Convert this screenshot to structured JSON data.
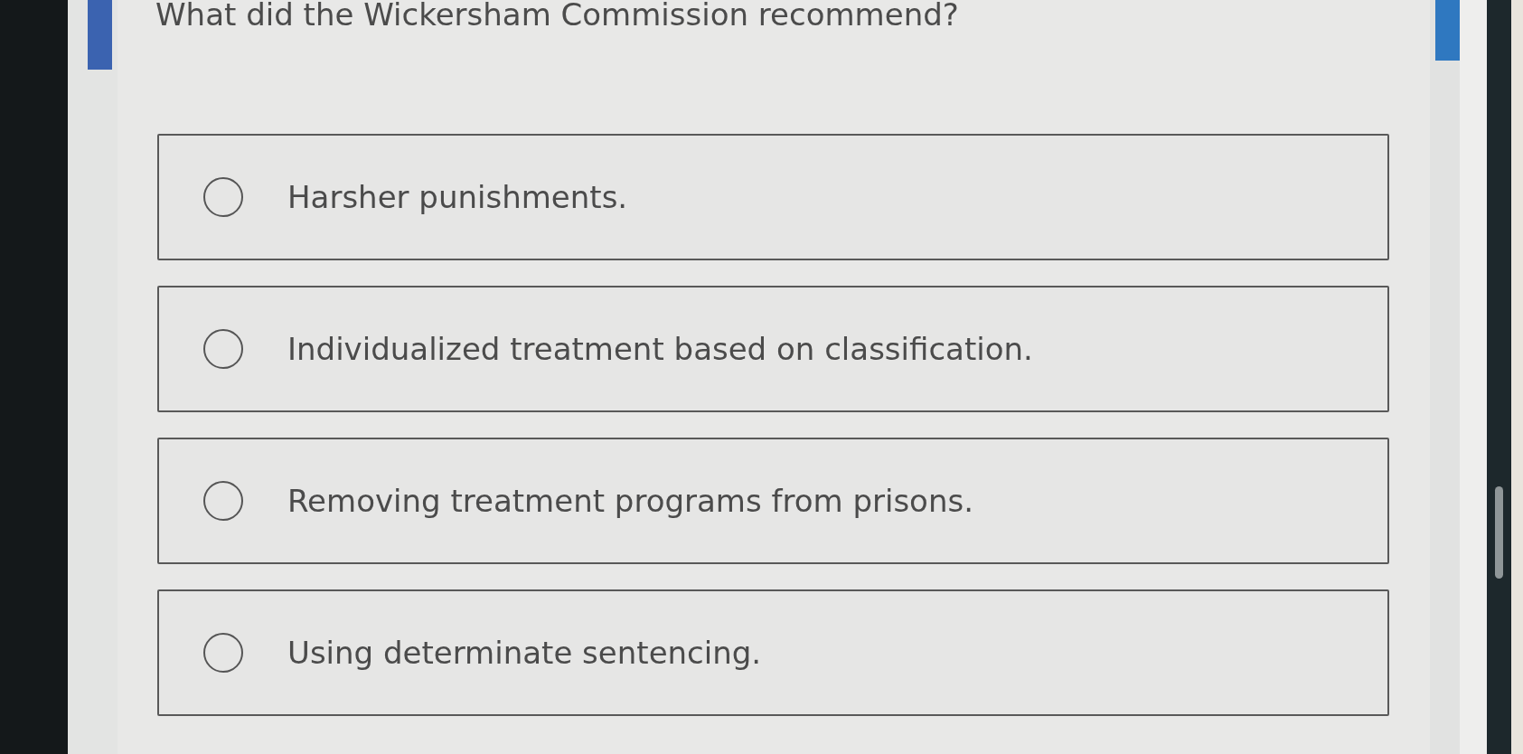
{
  "question": "What did the Wickersham Commission recommend?",
  "options": [
    {
      "label": "Harsher punishments.",
      "selected": false
    },
    {
      "label": "Individualized treatment based on classification.",
      "selected": false
    },
    {
      "label": "Removing treatment programs from prisons.",
      "selected": false
    },
    {
      "label": "Using determinate sentencing.",
      "selected": false
    }
  ]
}
